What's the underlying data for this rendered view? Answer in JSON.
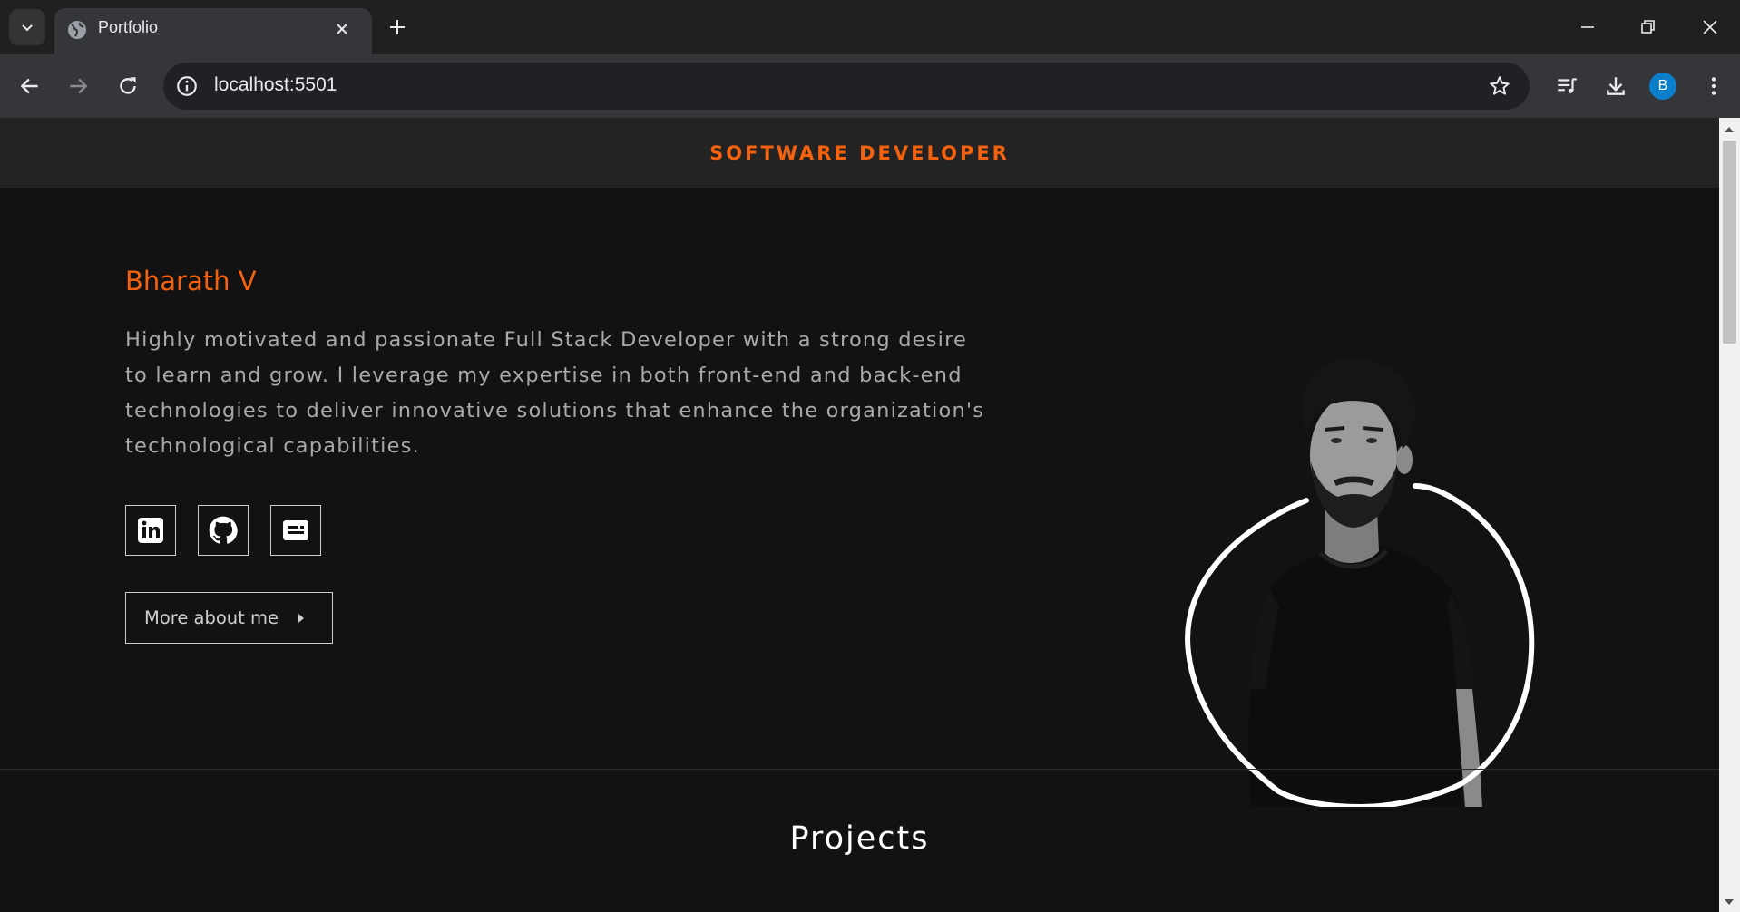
{
  "browser": {
    "tab_title": "Portfolio",
    "url": "localhost:5501",
    "profile_initial": "B"
  },
  "site": {
    "header_title": "SOFTWARE DEVELOPER",
    "name": "Bharath V",
    "description": "Highly motivated and passionate Full Stack Developer with a strong desire to learn and grow. I leverage my expertise in both front-end and back-end technologies to deliver innovative solutions that enhance the organization's technological capabilities.",
    "social_links": [
      "linkedin-icon",
      "github-icon",
      "resume-icon"
    ],
    "more_button_label": "More about me",
    "projects_heading": "Projects"
  },
  "colors": {
    "accent": "#f4620f",
    "page_background": "#121212",
    "header_background": "#232323",
    "text_muted": "#a9a9a9"
  }
}
